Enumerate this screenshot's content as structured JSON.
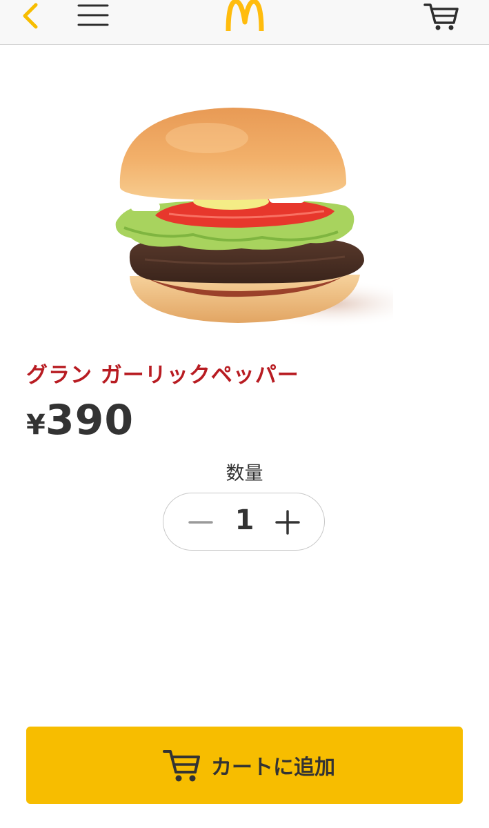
{
  "header": {
    "back_icon": "chevron-left-icon",
    "menu_icon": "hamburger-menu-icon",
    "logo": "golden-arches-logo",
    "cart_icon": "shopping-cart-icon"
  },
  "product": {
    "image": "burger-photo",
    "name": "グラン ガーリックペッパー",
    "price_symbol": "¥",
    "price_amount": "390"
  },
  "quantity": {
    "label": "数量",
    "value": "1",
    "minus_icon": "minus-icon",
    "plus_icon": "plus-icon"
  },
  "add_to_cart": {
    "label": "カートに追加",
    "icon": "shopping-cart-icon"
  },
  "colors": {
    "accent_yellow": "#f7bd00",
    "logo_yellow": "#ffbc0d",
    "product_name_red": "#b81c22",
    "text_dark": "#333333"
  }
}
